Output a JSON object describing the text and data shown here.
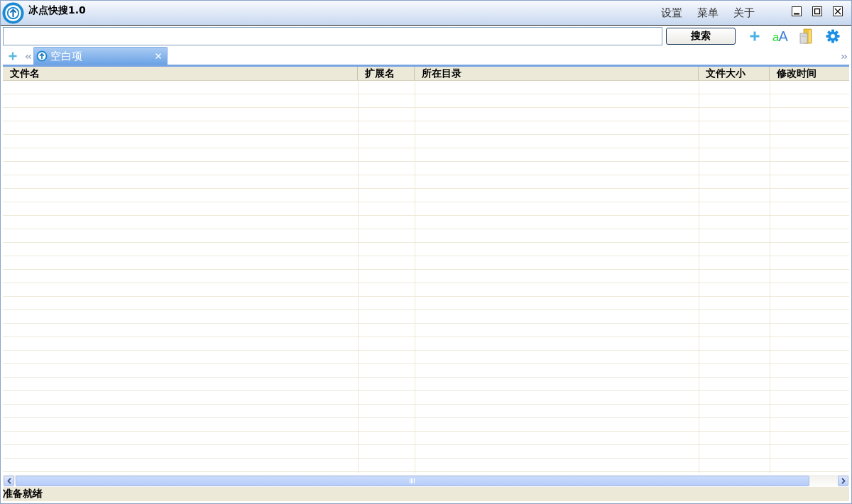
{
  "window": {
    "title": "冰点快搜1.0",
    "menu": [
      "设置",
      "菜单",
      "关于"
    ]
  },
  "toolbar": {
    "search_button": "搜索",
    "font_button": [
      "a",
      "A"
    ]
  },
  "tabs": [
    {
      "label": "空白项",
      "selected": true
    }
  ],
  "table": {
    "columns": [
      "文件名",
      "扩展名",
      "所在目录",
      "文件大小",
      "修改时间"
    ]
  },
  "status_bar": "准备就绪"
}
